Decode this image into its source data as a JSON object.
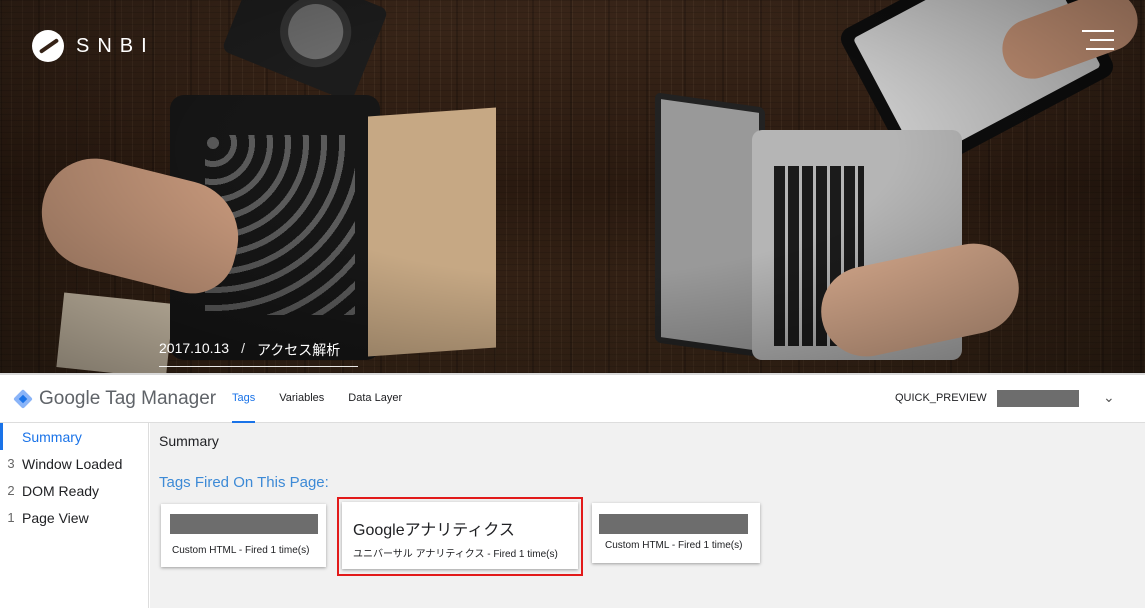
{
  "hero": {
    "logo_text": "SNBI",
    "date": "2017.10.13",
    "separator": "/",
    "category": "アクセス解析"
  },
  "gtm": {
    "brand_google": "Google",
    "brand_product": "Tag Manager",
    "tabs": [
      {
        "label": "Tags",
        "active": true
      },
      {
        "label": "Variables",
        "active": false
      },
      {
        "label": "Data Layer",
        "active": false
      }
    ],
    "quick_preview_label": "QUICK_PREVIEW",
    "accent_color": "#1a73e8"
  },
  "sidebar": {
    "items": [
      {
        "num": "",
        "label": "Summary",
        "active": true
      },
      {
        "num": "3",
        "label": "Window Loaded",
        "active": false
      },
      {
        "num": "2",
        "label": "DOM Ready",
        "active": false
      },
      {
        "num": "1",
        "label": "Page View",
        "active": false
      }
    ]
  },
  "main": {
    "title": "Summary",
    "fired_heading": "Tags Fired On This Page:",
    "tags": [
      {
        "title": "",
        "subtitle": "Custom HTML - Fired 1 time(s)",
        "redacted": true
      },
      {
        "title": "Googleアナリティクス",
        "subtitle": "ユニバーサル アナリティクス - Fired 1 time(s)",
        "redacted": false,
        "highlighted": true
      },
      {
        "title": "",
        "subtitle": "Custom HTML - Fired 1 time(s)",
        "redacted": true
      }
    ],
    "highlight_color": "#e21a1a"
  }
}
